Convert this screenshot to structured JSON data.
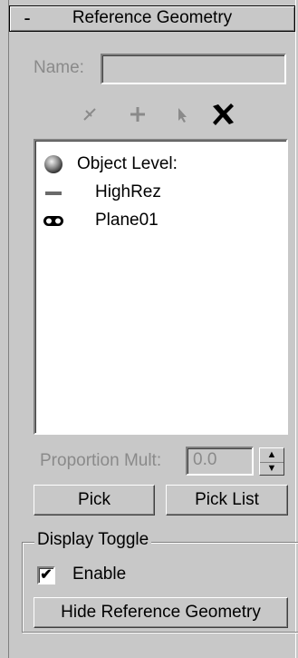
{
  "rollout": {
    "collapse_symbol": "-",
    "title": "Reference Geometry"
  },
  "name_field": {
    "label": "Name:",
    "value": ""
  },
  "toolbar": {
    "tools": [
      {
        "name": "remove-icon",
        "symbol": "✕",
        "enabled": false
      },
      {
        "name": "add-icon",
        "symbol": "+",
        "enabled": false
      },
      {
        "name": "pick-cursor-icon",
        "symbol": "➤",
        "enabled": false
      },
      {
        "name": "delete-icon",
        "symbol": "✖",
        "enabled": true
      }
    ]
  },
  "list": {
    "items": [
      {
        "label": "Object Level:",
        "icon": "sphere-icon"
      },
      {
        "label": "HighRez",
        "icon": "dash-icon"
      },
      {
        "label": "Plane01",
        "icon": "goggles-icon"
      }
    ]
  },
  "proportion": {
    "label": "Proportion Mult:",
    "value": "0.0"
  },
  "buttons": {
    "pick": "Pick",
    "pick_list": "Pick List"
  },
  "display_toggle": {
    "group_label": "Display Toggle",
    "enable_label": "Enable",
    "enable_checked": true,
    "hide_button": "Hide Reference Geometry"
  },
  "colors": {
    "panel_bg": "#c8c8c8",
    "disabled_text": "#8a8a8a",
    "list_bg": "#ffffff"
  }
}
